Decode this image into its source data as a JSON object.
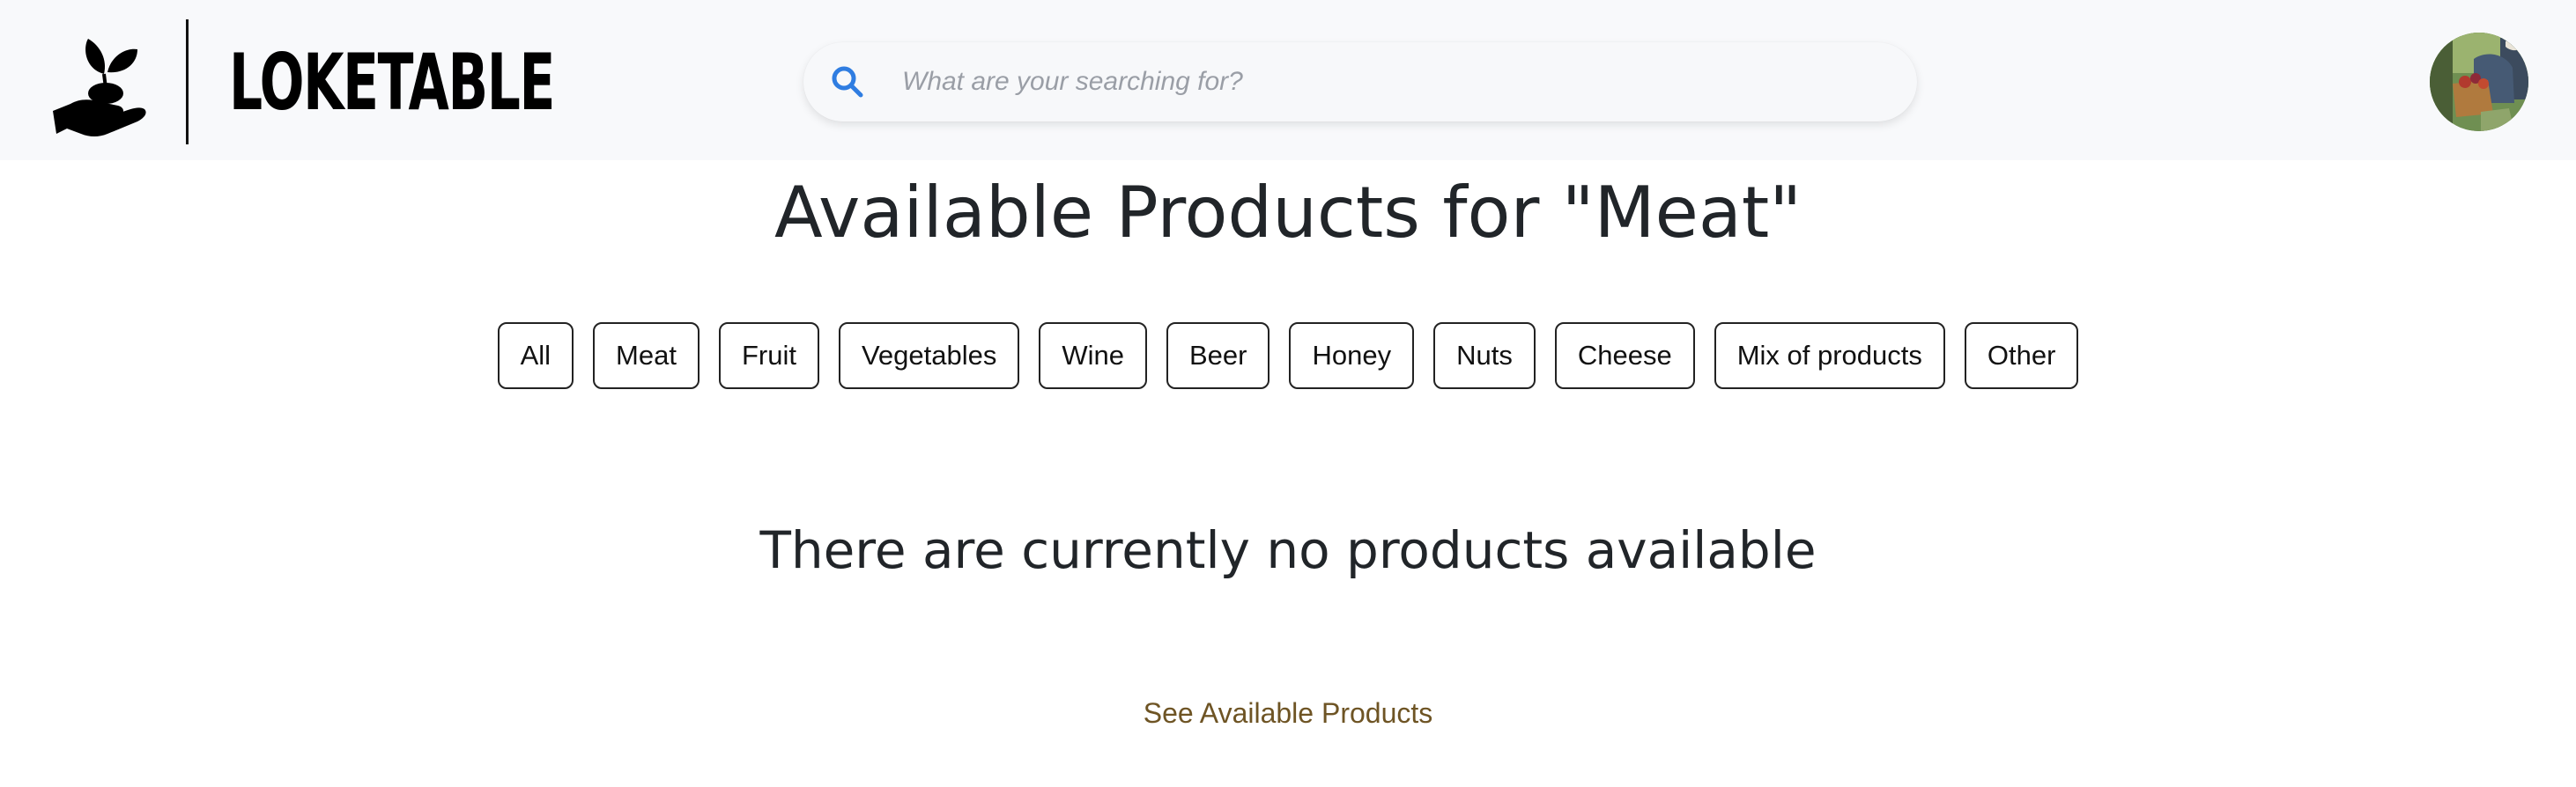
{
  "header": {
    "logo_text": "LOKETABLE",
    "search": {
      "placeholder": "What are your searching for?",
      "value": ""
    },
    "avatar_icon": "user-avatar-photo"
  },
  "main": {
    "title": "Available Products for \"Meat\"",
    "filters": [
      "All",
      "Meat",
      "Fruit",
      "Vegetables",
      "Wine",
      "Beer",
      "Honey",
      "Nuts",
      "Cheese",
      "Mix of products",
      "Other"
    ],
    "empty_message": "There are currently no products available",
    "see_link": "See Available Products"
  },
  "colors": {
    "header_bg": "#f8f9fb",
    "search_icon": "#2f7de1",
    "link": "#6e5424",
    "text": "#212529"
  }
}
